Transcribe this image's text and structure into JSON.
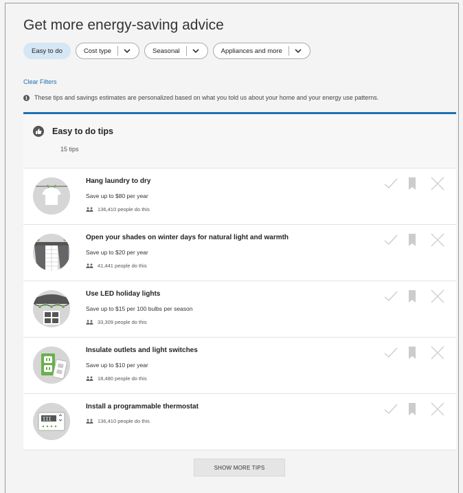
{
  "page": {
    "title": "Get more energy-saving advice",
    "clear_filters": "Clear Filters",
    "note": "These tips and savings estimates are personalized based on what you told us about your home and your energy use patterns."
  },
  "filters": [
    {
      "label": "Easy to do",
      "active": true,
      "dropdown": false
    },
    {
      "label": "Cost type",
      "active": false,
      "dropdown": true
    },
    {
      "label": "Seasonal",
      "active": false,
      "dropdown": true
    },
    {
      "label": "Appliances and more",
      "active": false,
      "dropdown": true
    }
  ],
  "panel": {
    "title": "Easy to do tips",
    "count": "15 tips",
    "icon": "thumbs-up-icon"
  },
  "tips": [
    {
      "title": "Hang laundry to dry",
      "savings": "Save up to $80 per year",
      "people": "136,410 people do this",
      "icon": "laundry-shirt-icon"
    },
    {
      "title": "Open your shades on winter days for natural light and warmth",
      "savings": "Save up to $20 per year",
      "people": "41,441 people do this",
      "icon": "window-shades-icon"
    },
    {
      "title": "Use LED holiday lights",
      "savings": "Save up to $15 per 100 bulbs per season",
      "people": "33,309 people do this",
      "icon": "holiday-lights-icon"
    },
    {
      "title": "Insulate outlets and light switches",
      "savings": "Save up to $10 per year",
      "people": "18,480 people do this",
      "icon": "outlet-icon"
    },
    {
      "title": "Install a programmable thermostat",
      "savings": "",
      "people": "136,410 people do this",
      "icon": "thermostat-icon"
    }
  ],
  "show_more": "SHOW MORE TIPS",
  "colors": {
    "accent": "#1a6fb5",
    "active_pill": "#d5e7f4",
    "green": "#6ab04c"
  }
}
